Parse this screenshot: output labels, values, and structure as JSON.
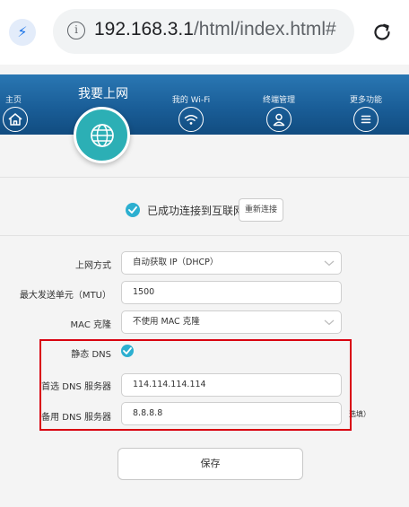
{
  "browser": {
    "url_host": "192.168.3.1",
    "url_path": "/html/index.html#",
    "bolt_icon": "lightning-bolt-icon",
    "info_icon": "info-icon",
    "reload_icon": "reload-icon"
  },
  "nav": {
    "items": [
      {
        "label": "主页",
        "icon": "home-icon"
      },
      {
        "label": "我要上网",
        "icon": "globe-icon",
        "active": true
      },
      {
        "label": "我的 Wi-Fi",
        "icon": "wifi-icon"
      },
      {
        "label": "终端管理",
        "icon": "user-icon"
      },
      {
        "label": "更多功能",
        "icon": "menu-icon"
      }
    ],
    "colors": {
      "bar": "#1a5e98",
      "active_circle": "#2cafb5"
    }
  },
  "status": {
    "text": "已成功连接到互联网",
    "reconnect_label": "重新连接",
    "check_color": "#2cafd0"
  },
  "form": {
    "connection_type": {
      "label": "上网方式",
      "value": "自动获取 IP（DHCP）"
    },
    "mtu": {
      "label": "最大发送单元（MTU）",
      "value": "1500"
    },
    "mac_clone": {
      "label": "MAC 克隆",
      "value": "不使用 MAC 克隆"
    },
    "static_dns": {
      "label": "静态 DNS",
      "checked": true
    },
    "primary_dns": {
      "label": "首选 DNS 服务器",
      "value": "114.114.114.114"
    },
    "secondary_dns": {
      "label": "备用 DNS 服务器",
      "value": "8.8.8.8",
      "note": "选填）"
    },
    "highlight_color": "#d9000f"
  },
  "save_label": "保存"
}
